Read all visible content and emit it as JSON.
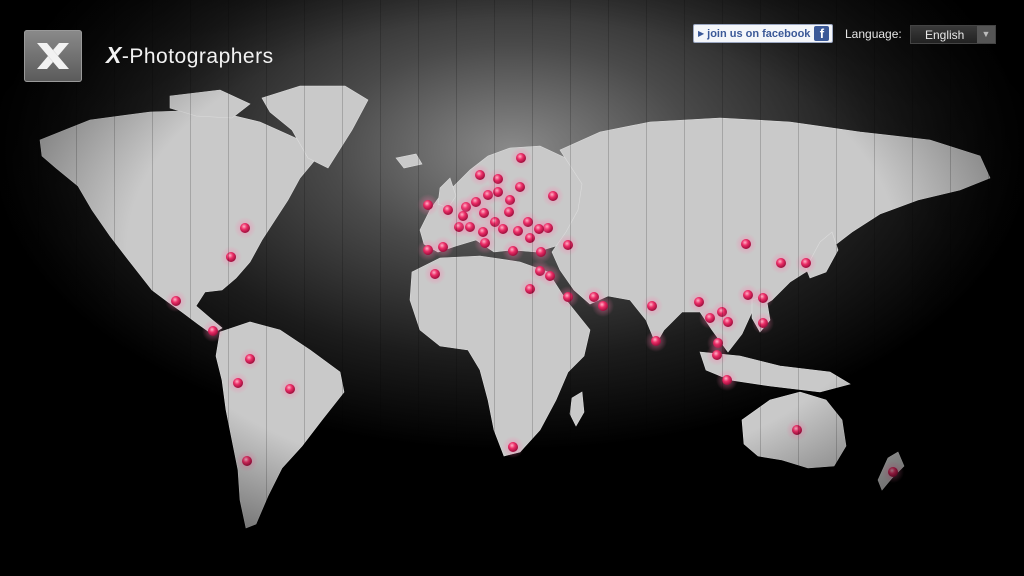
{
  "header": {
    "brand_prefix": "X",
    "brand_suffix": "-Photographers",
    "facebook": {
      "prefix": "join us on",
      "name": "facebook",
      "icon": "f"
    },
    "language_label": "Language:",
    "language_value": "English"
  },
  "colors": {
    "pin": "#e3245f",
    "pin_highlight": "#ff8fb0",
    "land": "#c9c9c9",
    "facebook_blue": "#3b5998"
  },
  "icons": {
    "logo": "x-logo-icon",
    "facebook": "facebook-icon",
    "language_caret": "chevron-down-icon",
    "pin": "location-pin-icon"
  },
  "map_pins_count": 64
}
